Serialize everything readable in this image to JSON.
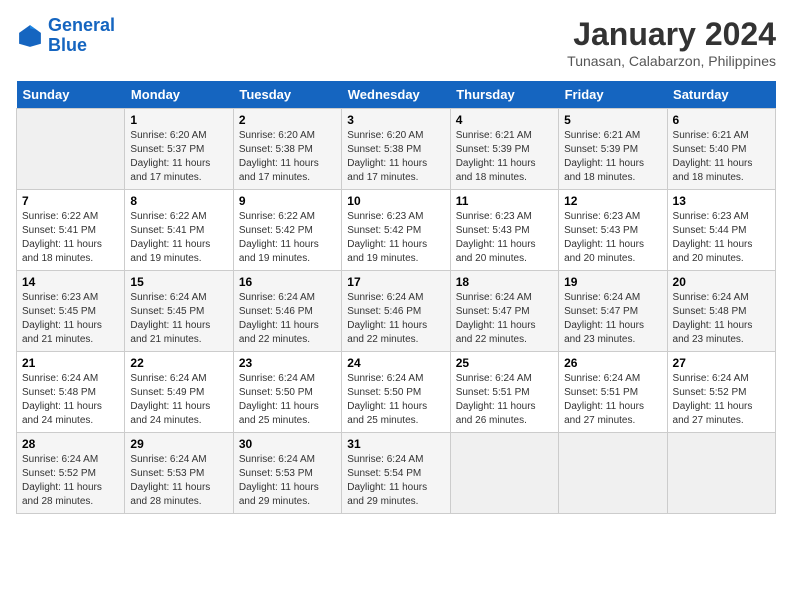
{
  "logo": {
    "line1": "General",
    "line2": "Blue"
  },
  "title": "January 2024",
  "subtitle": "Tunasan, Calabarzon, Philippines",
  "days_header": [
    "Sunday",
    "Monday",
    "Tuesday",
    "Wednesday",
    "Thursday",
    "Friday",
    "Saturday"
  ],
  "weeks": [
    [
      {
        "num": "",
        "info": ""
      },
      {
        "num": "1",
        "info": "Sunrise: 6:20 AM\nSunset: 5:37 PM\nDaylight: 11 hours\nand 17 minutes."
      },
      {
        "num": "2",
        "info": "Sunrise: 6:20 AM\nSunset: 5:38 PM\nDaylight: 11 hours\nand 17 minutes."
      },
      {
        "num": "3",
        "info": "Sunrise: 6:20 AM\nSunset: 5:38 PM\nDaylight: 11 hours\nand 17 minutes."
      },
      {
        "num": "4",
        "info": "Sunrise: 6:21 AM\nSunset: 5:39 PM\nDaylight: 11 hours\nand 18 minutes."
      },
      {
        "num": "5",
        "info": "Sunrise: 6:21 AM\nSunset: 5:39 PM\nDaylight: 11 hours\nand 18 minutes."
      },
      {
        "num": "6",
        "info": "Sunrise: 6:21 AM\nSunset: 5:40 PM\nDaylight: 11 hours\nand 18 minutes."
      }
    ],
    [
      {
        "num": "7",
        "info": "Sunrise: 6:22 AM\nSunset: 5:41 PM\nDaylight: 11 hours\nand 18 minutes."
      },
      {
        "num": "8",
        "info": "Sunrise: 6:22 AM\nSunset: 5:41 PM\nDaylight: 11 hours\nand 19 minutes."
      },
      {
        "num": "9",
        "info": "Sunrise: 6:22 AM\nSunset: 5:42 PM\nDaylight: 11 hours\nand 19 minutes."
      },
      {
        "num": "10",
        "info": "Sunrise: 6:23 AM\nSunset: 5:42 PM\nDaylight: 11 hours\nand 19 minutes."
      },
      {
        "num": "11",
        "info": "Sunrise: 6:23 AM\nSunset: 5:43 PM\nDaylight: 11 hours\nand 20 minutes."
      },
      {
        "num": "12",
        "info": "Sunrise: 6:23 AM\nSunset: 5:43 PM\nDaylight: 11 hours\nand 20 minutes."
      },
      {
        "num": "13",
        "info": "Sunrise: 6:23 AM\nSunset: 5:44 PM\nDaylight: 11 hours\nand 20 minutes."
      }
    ],
    [
      {
        "num": "14",
        "info": "Sunrise: 6:23 AM\nSunset: 5:45 PM\nDaylight: 11 hours\nand 21 minutes."
      },
      {
        "num": "15",
        "info": "Sunrise: 6:24 AM\nSunset: 5:45 PM\nDaylight: 11 hours\nand 21 minutes."
      },
      {
        "num": "16",
        "info": "Sunrise: 6:24 AM\nSunset: 5:46 PM\nDaylight: 11 hours\nand 22 minutes."
      },
      {
        "num": "17",
        "info": "Sunrise: 6:24 AM\nSunset: 5:46 PM\nDaylight: 11 hours\nand 22 minutes."
      },
      {
        "num": "18",
        "info": "Sunrise: 6:24 AM\nSunset: 5:47 PM\nDaylight: 11 hours\nand 22 minutes."
      },
      {
        "num": "19",
        "info": "Sunrise: 6:24 AM\nSunset: 5:47 PM\nDaylight: 11 hours\nand 23 minutes."
      },
      {
        "num": "20",
        "info": "Sunrise: 6:24 AM\nSunset: 5:48 PM\nDaylight: 11 hours\nand 23 minutes."
      }
    ],
    [
      {
        "num": "21",
        "info": "Sunrise: 6:24 AM\nSunset: 5:48 PM\nDaylight: 11 hours\nand 24 minutes."
      },
      {
        "num": "22",
        "info": "Sunrise: 6:24 AM\nSunset: 5:49 PM\nDaylight: 11 hours\nand 24 minutes."
      },
      {
        "num": "23",
        "info": "Sunrise: 6:24 AM\nSunset: 5:50 PM\nDaylight: 11 hours\nand 25 minutes."
      },
      {
        "num": "24",
        "info": "Sunrise: 6:24 AM\nSunset: 5:50 PM\nDaylight: 11 hours\nand 25 minutes."
      },
      {
        "num": "25",
        "info": "Sunrise: 6:24 AM\nSunset: 5:51 PM\nDaylight: 11 hours\nand 26 minutes."
      },
      {
        "num": "26",
        "info": "Sunrise: 6:24 AM\nSunset: 5:51 PM\nDaylight: 11 hours\nand 27 minutes."
      },
      {
        "num": "27",
        "info": "Sunrise: 6:24 AM\nSunset: 5:52 PM\nDaylight: 11 hours\nand 27 minutes."
      }
    ],
    [
      {
        "num": "28",
        "info": "Sunrise: 6:24 AM\nSunset: 5:52 PM\nDaylight: 11 hours\nand 28 minutes."
      },
      {
        "num": "29",
        "info": "Sunrise: 6:24 AM\nSunset: 5:53 PM\nDaylight: 11 hours\nand 28 minutes."
      },
      {
        "num": "30",
        "info": "Sunrise: 6:24 AM\nSunset: 5:53 PM\nDaylight: 11 hours\nand 29 minutes."
      },
      {
        "num": "31",
        "info": "Sunrise: 6:24 AM\nSunset: 5:54 PM\nDaylight: 11 hours\nand 29 minutes."
      },
      {
        "num": "",
        "info": ""
      },
      {
        "num": "",
        "info": ""
      },
      {
        "num": "",
        "info": ""
      }
    ]
  ]
}
